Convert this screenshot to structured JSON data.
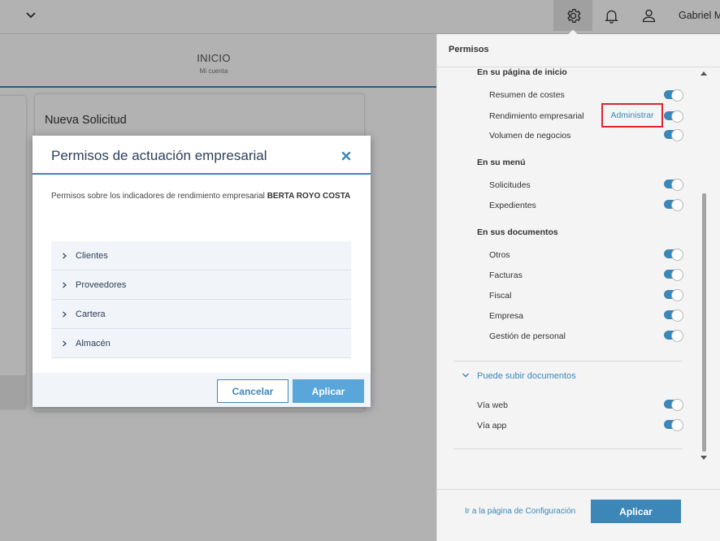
{
  "topbar": {
    "user_name": "Gabriel M",
    "icons": [
      "chevron-down-icon",
      "gear-icon",
      "bell-icon",
      "user-icon"
    ]
  },
  "header": {
    "title": "INICIO",
    "subtitle": "Mi cuenta"
  },
  "background": {
    "card_title": "Nueva Solicitud"
  },
  "permissions_panel": {
    "title": "Permisos",
    "sections": [
      {
        "title": "En su página de inicio",
        "items": [
          {
            "label": "Resumen de costes",
            "enabled": true
          },
          {
            "label": "Rendimiento empresarial",
            "enabled": true,
            "action": "Administrar"
          },
          {
            "label": "Volumen de negocios",
            "enabled": true
          }
        ]
      },
      {
        "title": "En su menú",
        "items": [
          {
            "label": "Solicitudes",
            "enabled": true
          },
          {
            "label": "Expedientes",
            "enabled": true
          }
        ]
      },
      {
        "title": "En sus documentos",
        "items": [
          {
            "label": "Otros",
            "enabled": true
          },
          {
            "label": "Facturas",
            "enabled": true
          },
          {
            "label": "Fiscal",
            "enabled": true
          },
          {
            "label": "Empresa",
            "enabled": true
          },
          {
            "label": "Gestión de personal",
            "enabled": true
          }
        ]
      }
    ],
    "upload_section": {
      "title": "Puede subir documentos",
      "items": [
        {
          "label": "Vía web",
          "enabled": true
        },
        {
          "label": "Vía app",
          "enabled": true
        }
      ]
    },
    "footer": {
      "config_link": "Ir a la página de Configuración",
      "apply_label": "Aplicar"
    }
  },
  "modal": {
    "title": "Permisos de actuación empresarial",
    "description": "Permisos sobre los indicadores de rendimiento empresarial",
    "description_bold": "BERTA ROYO COSTA",
    "categories": [
      "Clientes",
      "Proveedores",
      "Cartera",
      "Almacén"
    ],
    "cancel_label": "Cancelar",
    "apply_label": "Aplicar"
  },
  "colors": {
    "accent": "#3c87b8",
    "accent_light": "#58a6da",
    "highlight_border": "#e0242f",
    "title_dark": "#2d4159"
  }
}
